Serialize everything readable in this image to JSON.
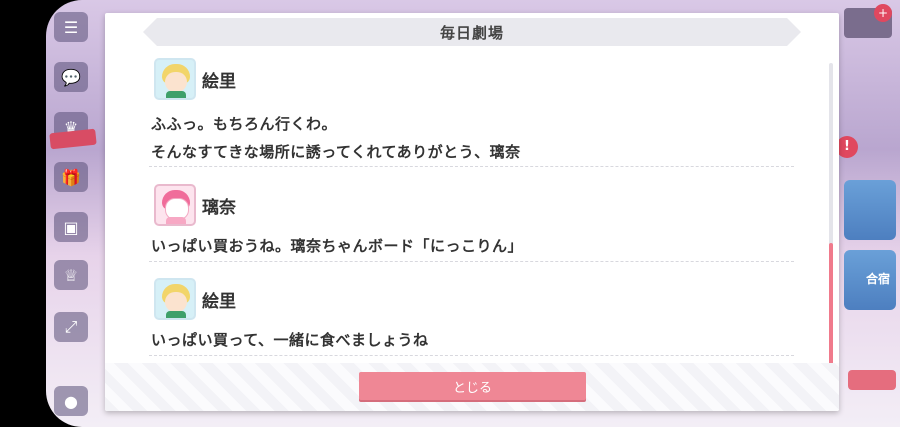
{
  "modal": {
    "title": "毎日劇場",
    "close_label": "とじる"
  },
  "dialogue": [
    {
      "speaker": "絵里",
      "avatar": "eli-avatar",
      "lines": [
        "ふふっ。もちろん行くわ。",
        "そんなすてきな場所に誘ってくれてありがとう、璃奈"
      ]
    },
    {
      "speaker": "璃奈",
      "avatar": "rina-avatar",
      "lines": [
        "いっぱい買おうね。璃奈ちゃんボード「にっこりん」"
      ]
    },
    {
      "speaker": "絵里",
      "avatar": "eli-avatar",
      "lines": [
        "いっぱい買って、一緒に食べましょうね"
      ]
    }
  ],
  "background": {
    "right_tile_label": "合宿"
  },
  "colors": {
    "accent": "#ef8795",
    "scroll_thumb": "#f07a8c",
    "alert": "#e0485f"
  },
  "icons": [
    "menu-icon",
    "chat-icon",
    "present-icon",
    "gift-icon",
    "monitor-icon",
    "trophy-icon",
    "expand-icon",
    "profile-icon",
    "alert-icon"
  ]
}
